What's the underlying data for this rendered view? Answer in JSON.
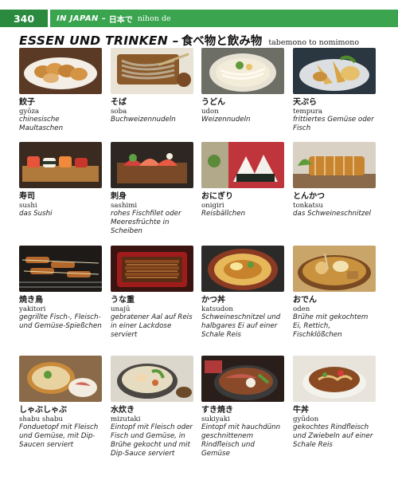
{
  "header": {
    "page_number": "340",
    "section_de": "IN JAPAN",
    "section_sep": "–",
    "section_jp": "日本で",
    "section_romaji": "nihon de"
  },
  "title": {
    "de": "ESSEN UND TRINKEN –",
    "jp": "食べ物と飲み物",
    "romaji": "tabemono to nomimono"
  },
  "items": [
    {
      "jp": "餃子",
      "romaji": "gyōza",
      "meaning": "chinesische Maultaschen",
      "image": "gyoza-photo"
    },
    {
      "jp": "そば",
      "romaji": "soba",
      "meaning": "Buchweizennudeln",
      "image": "soba-photo"
    },
    {
      "jp": "うどん",
      "romaji": "udon",
      "meaning": "Weizennudeln",
      "image": "udon-photo"
    },
    {
      "jp": "天ぷら",
      "romaji": "tempura",
      "meaning": "frittiertes Gemüse oder Fisch",
      "image": "tempura-photo"
    },
    {
      "jp": "寿司",
      "romaji": "sushi",
      "meaning": "das Sushi",
      "image": "sushi-photo"
    },
    {
      "jp": "刺身",
      "romaji": "sashimi",
      "meaning": "rohes Fischfilet oder Meeresfrüchte in Scheiben",
      "image": "sashimi-photo"
    },
    {
      "jp": "おにぎり",
      "romaji": "onigiri",
      "meaning": "Reisbällchen",
      "image": "onigiri-photo"
    },
    {
      "jp": "とんかつ",
      "romaji": "tonkatsu",
      "meaning": "das Schweineschnitzel",
      "image": "tonkatsu-photo"
    },
    {
      "jp": "焼き鳥",
      "romaji": "yakitori",
      "meaning": "gegrillte Fisch-, Fleisch- und Gemüse-Spießchen",
      "image": "yakitori-photo"
    },
    {
      "jp": "うな重",
      "romaji": "unajū",
      "meaning": "gebratener Aal auf Reis in einer Lackdose serviert",
      "image": "unaju-photo"
    },
    {
      "jp": "かつ丼",
      "romaji": "katsudon",
      "meaning": "Schweineschnitzel und halbgares Ei auf einer Schale Reis",
      "image": "katsudon-photo"
    },
    {
      "jp": "おでん",
      "romaji": "oden",
      "meaning": "Brühe mit gekochtem Ei, Rettich, Fischklößchen",
      "image": "oden-photo"
    },
    {
      "jp": "しゃぶしゃぶ",
      "romaji": "shabu shabu",
      "meaning": "Fonduetopf mit Fleisch und Gemüse, mit Dip-Saucen serviert",
      "image": "shabushabu-photo"
    },
    {
      "jp": "水炊き",
      "romaji": "mizutaki",
      "meaning": "Eintopf mit Fleisch oder Fisch und Gemüse, in Brühe gekocht und mit Dip-Sauce serviert",
      "image": "mizutaki-photo"
    },
    {
      "jp": "すき焼き",
      "romaji": "sukiyaki",
      "meaning": "Eintopf mit hauchdünn geschnittenem Rindfleisch und Gemüse",
      "image": "sukiyaki-photo"
    },
    {
      "jp": "牛丼",
      "romaji": "gyūdon",
      "meaning": "gekochtes Rindfleisch und Zwiebeln auf einer Schale Reis",
      "image": "gyudon-photo"
    }
  ]
}
